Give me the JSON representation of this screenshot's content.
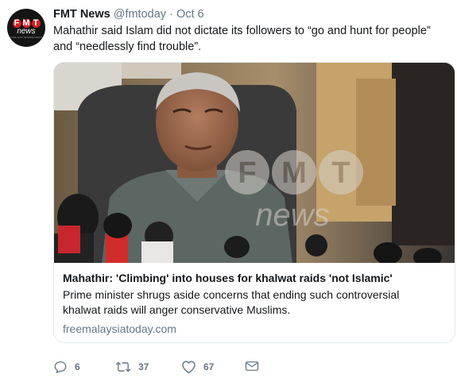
{
  "tweet": {
    "author_name": "FMT News",
    "handle": "@fmtoday",
    "separator": "·",
    "date": "Oct 6",
    "text": "Mahathir said Islam did not dictate its followers to “go and hunt for people” and “needlessly find trouble”."
  },
  "avatar": {
    "letters": [
      "F",
      "M",
      "T"
    ],
    "word": "news",
    "tagline": "FREE AND INDEPENDENT"
  },
  "card": {
    "image_icon": "news-photo",
    "watermark_letters": [
      "F",
      "M",
      "T"
    ],
    "watermark_word": "news",
    "title": "Mahathir: 'Climbing' into houses for khalwat raids 'not Islamic'",
    "description": "Prime minister shrugs aside concerns that ending such controversial khalwat raids will anger conservative Muslims.",
    "domain": "freemalaysiatoday.com"
  },
  "actions": {
    "reply_count": "6",
    "retweet_count": "37",
    "like_count": "67"
  },
  "colors": {
    "text": "#14171a",
    "muted": "#657786",
    "border": "#e1e8ed",
    "brand_red": "#d32027"
  }
}
